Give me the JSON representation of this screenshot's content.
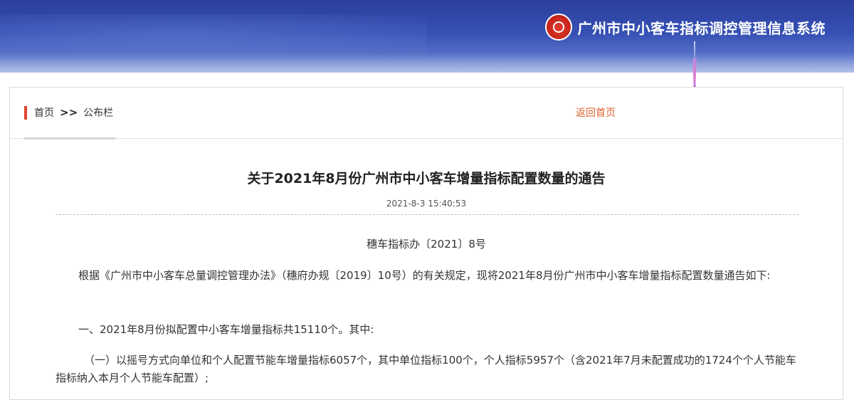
{
  "header": {
    "system_title": "广州市中小客车指标调控管理信息系统"
  },
  "breadcrumb": {
    "home": "首页",
    "separator": ">>",
    "current": "公布栏",
    "back_home": "返回首页"
  },
  "article": {
    "title": "关于2021年8月份广州市中小客车增量指标配置数量的通告",
    "date": "2021-8-3 15:40:53",
    "doc_number": "穗车指标办〔2021〕8号",
    "paragraphs": [
      "根据《广州市中小客车总量调控管理办法》（穗府办规〔2019〕10号）的有关规定，现将2021年8月份广州市中小客车增量指标配置数量通告如下:",
      "一、2021年8月份拟配置中小客车增量指标共15110个。其中:",
      "（一）以摇号方式向单位和个人配置节能车增量指标6057个，其中单位指标100个，个人指标5957个（含2021年7月未配置成功的1724个个人节能车指标纳入本月个人节能车配置）;"
    ]
  },
  "colors": {
    "banner": "#3550b4",
    "accent_red": "#e0452c",
    "link_orange": "#e0602c"
  }
}
